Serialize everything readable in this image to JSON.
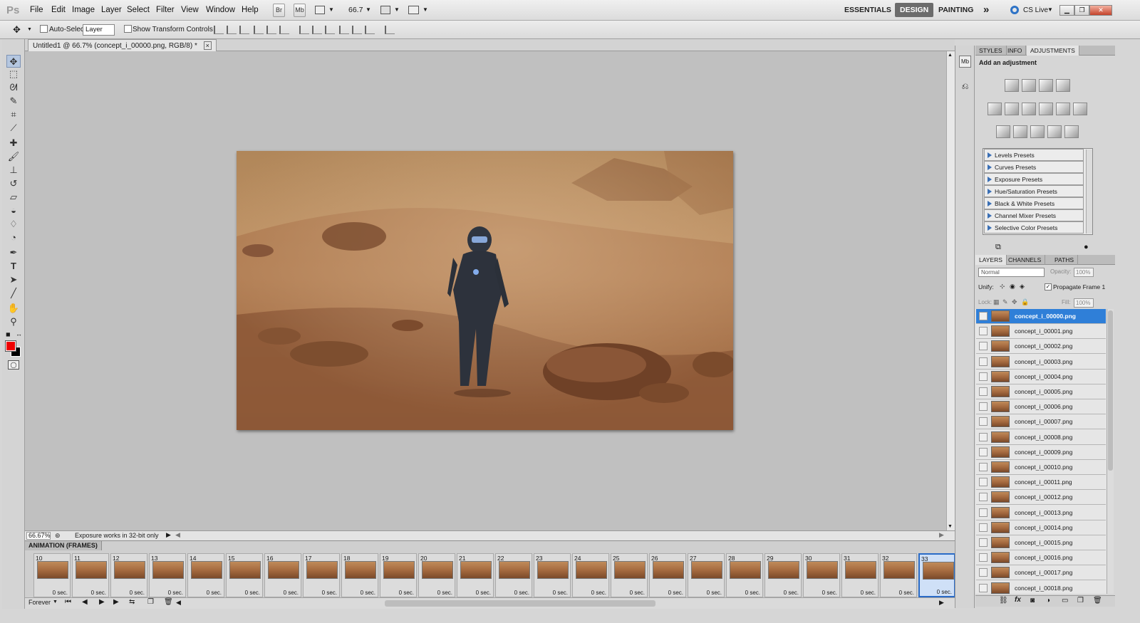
{
  "app": {
    "logo": "Ps"
  },
  "menu": [
    "File",
    "Edit",
    "Image",
    "Layer",
    "Select",
    "Filter",
    "View",
    "Window",
    "Help"
  ],
  "menubar": {
    "br_label": "Br",
    "mb_label": "Mb",
    "zoom": "66.7"
  },
  "workspaces": [
    "ESSENTIALS",
    "DESIGN",
    "PAINTING"
  ],
  "workspace_more": "»",
  "cslive": "CS Live",
  "options": {
    "auto_select": "Auto-Select:",
    "auto_select_value": "Layer",
    "show_transform": "Show Transform Controls"
  },
  "document": {
    "tab_title": "Untitled1 @ 66.7% (concept_i_00000.png, RGB/8) *",
    "close": "×"
  },
  "status": {
    "zoom": "66.67%",
    "message": "Exposure works in 32-bit only"
  },
  "animation": {
    "title": "ANIMATION (FRAMES)",
    "loop": "Forever",
    "frames": [
      {
        "num": "10",
        "delay": "0 sec."
      },
      {
        "num": "11",
        "delay": "0 sec."
      },
      {
        "num": "12",
        "delay": "0 sec."
      },
      {
        "num": "13",
        "delay": "0 sec."
      },
      {
        "num": "14",
        "delay": "0 sec."
      },
      {
        "num": "15",
        "delay": "0 sec."
      },
      {
        "num": "16",
        "delay": "0 sec."
      },
      {
        "num": "17",
        "delay": "0 sec."
      },
      {
        "num": "18",
        "delay": "0 sec."
      },
      {
        "num": "19",
        "delay": "0 sec."
      },
      {
        "num": "20",
        "delay": "0 sec."
      },
      {
        "num": "21",
        "delay": "0 sec."
      },
      {
        "num": "22",
        "delay": "0 sec."
      },
      {
        "num": "23",
        "delay": "0 sec."
      },
      {
        "num": "24",
        "delay": "0 sec."
      },
      {
        "num": "25",
        "delay": "0 sec."
      },
      {
        "num": "26",
        "delay": "0 sec."
      },
      {
        "num": "27",
        "delay": "0 sec."
      },
      {
        "num": "28",
        "delay": "0 sec."
      },
      {
        "num": "29",
        "delay": "0 sec."
      },
      {
        "num": "30",
        "delay": "0 sec."
      },
      {
        "num": "31",
        "delay": "0 sec."
      },
      {
        "num": "32",
        "delay": "0 sec."
      },
      {
        "num": "33",
        "delay": "0 sec."
      }
    ],
    "selected_frame": "33"
  },
  "adjustments": {
    "tabs": [
      "STYLES",
      "INFO",
      "ADJUSTMENTS"
    ],
    "heading": "Add an adjustment",
    "presets": [
      "Levels Presets",
      "Curves Presets",
      "Exposure Presets",
      "Hue/Saturation Presets",
      "Black & White Presets",
      "Channel Mixer Presets",
      "Selective Color Presets"
    ]
  },
  "layers_panel": {
    "tabs": [
      "LAYERS",
      "CHANNELS",
      "PATHS"
    ],
    "blend_mode": "Normal",
    "opacity_label": "Opacity:",
    "opacity": "100%",
    "unify_label": "Unify:",
    "propagate": "Propagate Frame 1",
    "lock_label": "Lock:",
    "fill_label": "Fill:",
    "fill": "100%",
    "layers": [
      "concept_i_00000.png",
      "concept_i_00001.png",
      "concept_i_00002.png",
      "concept_i_00003.png",
      "concept_i_00004.png",
      "concept_i_00005.png",
      "concept_i_00006.png",
      "concept_i_00007.png",
      "concept_i_00008.png",
      "concept_i_00009.png",
      "concept_i_00010.png",
      "concept_i_00011.png",
      "concept_i_00012.png",
      "concept_i_00013.png",
      "concept_i_00014.png",
      "concept_i_00015.png",
      "concept_i_00016.png",
      "concept_i_00017.png",
      "concept_i_00018.png"
    ],
    "selected_layer": "concept_i_00000.png"
  },
  "colors": {
    "foreground": "#ee0000",
    "background": "#000000",
    "selection": "#2f7fd8"
  }
}
